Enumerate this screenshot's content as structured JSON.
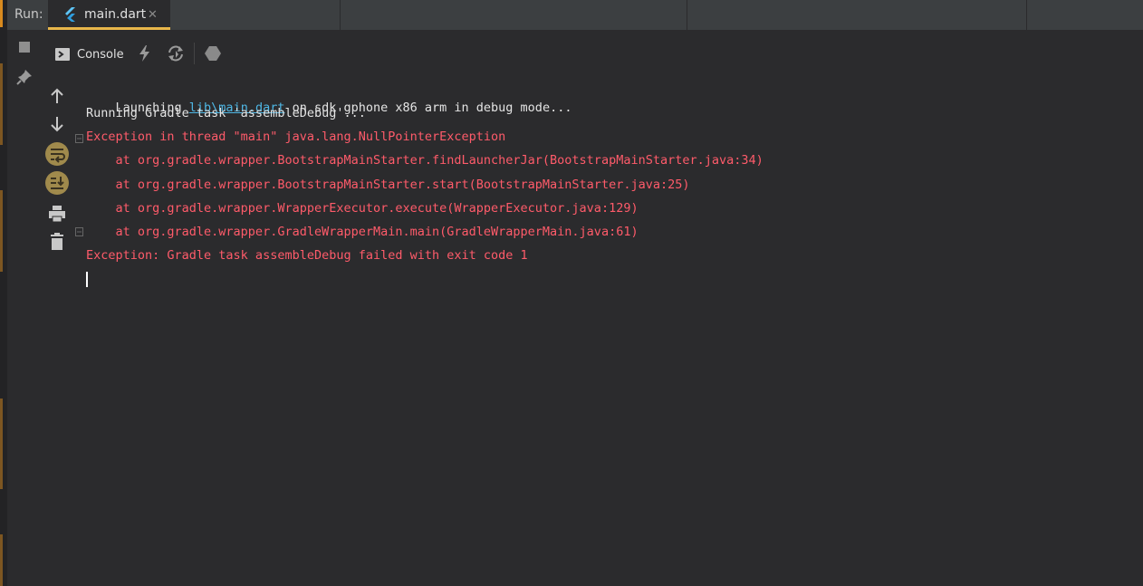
{
  "tabbar": {
    "run_label": "Run:",
    "tab_title": "main.dart",
    "close_glyph": "✕"
  },
  "console_toolbar": {
    "console_label": "Console"
  },
  "console": {
    "line1": {
      "prefix": "Launching ",
      "link": "lib\\main.dart",
      "suffix": " on sdk gphone x86 arm in debug mode..."
    },
    "line2": "Running Gradle task 'assembleDebug'...",
    "line3": "Exception in thread \"main\" java.lang.NullPointerException",
    "line4": "    at org.gradle.wrapper.BootstrapMainStarter.findLauncherJar(BootstrapMainStarter.java:34)",
    "line5": "    at org.gradle.wrapper.BootstrapMainStarter.start(BootstrapMainStarter.java:25)",
    "line6": "    at org.gradle.wrapper.WrapperExecutor.execute(WrapperExecutor.java:129)",
    "line7": "    at org.gradle.wrapper.GradleWrapperMain.main(GradleWrapperMain.java:61)",
    "line8": "Exception: Gradle task assembleDebug failed with exit code 1"
  },
  "icons": {
    "stop": "stop-icon",
    "pin": "pin-icon",
    "console": "console-icon",
    "lightning": "hot-reload-icon",
    "restart": "hot-restart-icon",
    "devtools": "devtools-icon",
    "up": "arrow-up-icon",
    "down": "arrow-down-icon",
    "soft_wrap": "soft-wrap-icon",
    "scroll_end": "scroll-to-end-icon",
    "print": "print-icon",
    "trash": "trash-icon"
  },
  "colors": {
    "background": "#2b2b2d",
    "tabbar": "#3c3f41",
    "active_tab_underline": "#e8b64a",
    "error_text": "#ff5b6a",
    "normal_text": "#e4e4e4",
    "link_text": "#4fb8e6"
  }
}
